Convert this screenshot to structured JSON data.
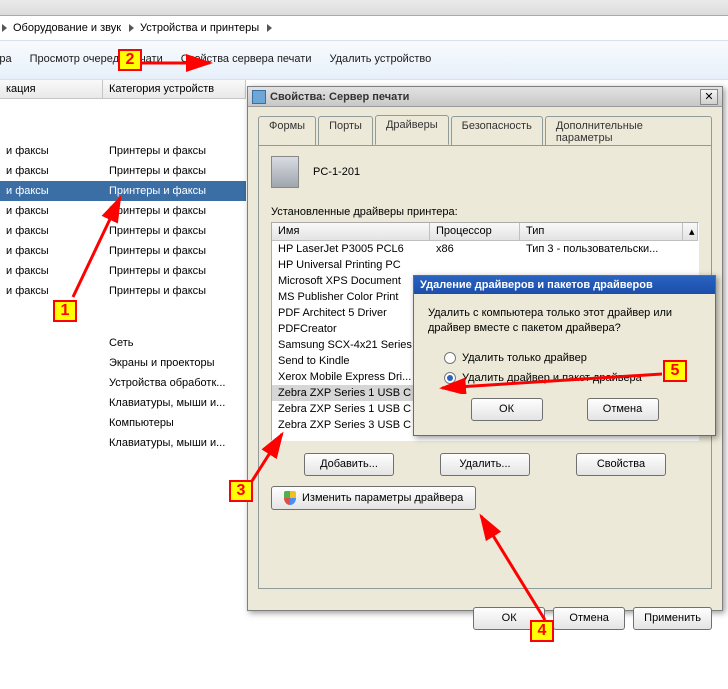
{
  "breadcrumbs": {
    "item1": "Оборудование и звук",
    "item2": "Устройства и принтеры"
  },
  "toolbar": {
    "t0": "ринтера",
    "t1": "Просмотр очереди печати",
    "t2": "Свойства сервера печати",
    "t3": "Удалить устройство"
  },
  "columns": {
    "h1": "кация",
    "h2": "Категория устройств"
  },
  "leftrows": {
    "c1": [
      "и факсы",
      "и факсы",
      "и факсы",
      "и факсы",
      "и факсы",
      "и факсы",
      "и факсы",
      "и факсы"
    ],
    "c2": [
      "Принтеры и факсы",
      "Принтеры и факсы",
      "Принтеры и факсы",
      "Принтеры и факсы",
      "Принтеры и факсы",
      "Принтеры и факсы",
      "Принтеры и факсы",
      "Принтеры и факсы"
    ],
    "extras": [
      "Сеть",
      "Экраны и проекторы",
      "Устройства обработк...",
      "Клавиатуры, мыши и...",
      "Компьютеры",
      "Клавиатуры, мыши и..."
    ]
  },
  "dialog": {
    "title": "Свойства: Сервер печати",
    "tabs": [
      "Формы",
      "Порты",
      "Драйверы",
      "Безопасность",
      "Дополнительные параметры"
    ],
    "server_name": "PC-1-201",
    "group_label": "Установленные драйверы принтера:",
    "lv_headers": {
      "c1": "Имя",
      "c2": "Процессор",
      "c3": "Тип"
    },
    "lv_rows": [
      {
        "name": "HP LaserJet P3005 PCL6",
        "proc": "x86",
        "type": "Тип 3 - пользовательски...",
        "sel": false
      },
      {
        "name": "HP Universal Printing PC",
        "proc": "",
        "type": "",
        "sel": false
      },
      {
        "name": "Microsoft XPS Document",
        "proc": "",
        "type": "",
        "sel": false
      },
      {
        "name": "MS Publisher Color Print",
        "proc": "",
        "type": "",
        "sel": false
      },
      {
        "name": "PDF Architect 5 Driver",
        "proc": "",
        "type": "",
        "sel": false
      },
      {
        "name": "PDFCreator",
        "proc": "",
        "type": "",
        "sel": false
      },
      {
        "name": "Samsung SCX-4x21 Series",
        "proc": "",
        "type": "",
        "sel": false
      },
      {
        "name": "Send to Kindle",
        "proc": "",
        "type": "",
        "sel": false
      },
      {
        "name": "Xerox Mobile Express Dri...",
        "proc": "",
        "type": "",
        "sel": false
      },
      {
        "name": "Zebra ZXP Series 1 USB C",
        "proc": "",
        "type": "",
        "sel": true
      },
      {
        "name": "Zebra ZXP Series 1 USB C",
        "proc": "",
        "type": "",
        "sel": false
      },
      {
        "name": "Zebra ZXP Series 3 USB C",
        "proc": "",
        "type": "",
        "sel": false
      }
    ],
    "buttons": {
      "add": "Добавить...",
      "remove": "Удалить...",
      "props": "Свойства",
      "change": "Изменить параметры драйвера"
    },
    "footer": {
      "ok": "ОК",
      "cancel": "Отмена",
      "apply": "Применить"
    }
  },
  "msgbox": {
    "title": "Удаление драйверов и пакетов драйверов",
    "text": "Удалить с компьютера только этот драйвер или драйвер вместе с пакетом драйвера?",
    "opt1": "Удалить только драйвер",
    "opt2": "Удалить драйвер и пакет драйвера",
    "ok": "ОК",
    "cancel": "Отмена"
  },
  "markers": {
    "m1": "1",
    "m2": "2",
    "m3": "3",
    "m4": "4",
    "m5": "5"
  }
}
